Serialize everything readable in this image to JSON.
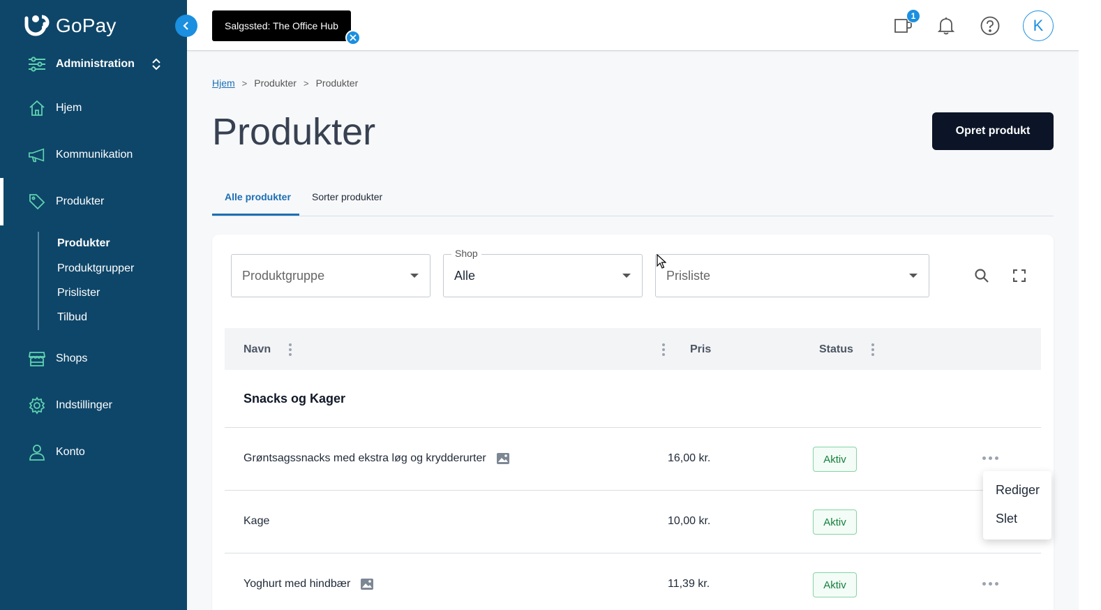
{
  "app": {
    "brand": "GoPay"
  },
  "sidebar": {
    "items": [
      {
        "label": "Administration",
        "icon": "sliders-icon"
      },
      {
        "label": "Hjem",
        "icon": "home-icon"
      },
      {
        "label": "Kommunikation",
        "icon": "megaphone-icon"
      },
      {
        "label": "Produkter",
        "icon": "tag-icon"
      },
      {
        "label": "Shops",
        "icon": "store-icon"
      },
      {
        "label": "Indstillinger",
        "icon": "gear-icon"
      },
      {
        "label": "Konto",
        "icon": "user-icon"
      }
    ],
    "subitems": [
      {
        "label": "Produkter"
      },
      {
        "label": "Produktgrupper"
      },
      {
        "label": "Prislister"
      },
      {
        "label": "Tilbud"
      }
    ]
  },
  "topbar": {
    "salgssted": "Salgssted: The Office Hub",
    "cart_badge": "1",
    "avatar_initial": "K"
  },
  "breadcrumb": {
    "home": "Hjem",
    "level1": "Produkter",
    "level2": "Produkter"
  },
  "page": {
    "title": "Produkter",
    "create_button": "Opret produkt"
  },
  "tabs": [
    {
      "label": "Alle produkter"
    },
    {
      "label": "Sorter produkter"
    }
  ],
  "filters": {
    "produktgruppe": {
      "placeholder": "Produktgruppe"
    },
    "shop": {
      "legend": "Shop",
      "value": "Alle"
    },
    "prisliste": {
      "placeholder": "Prisliste"
    }
  },
  "table": {
    "columns": {
      "name": "Navn",
      "price": "Pris",
      "status": "Status"
    },
    "group": "Snacks og Kager",
    "rows": [
      {
        "name": "Grøntsagssnacks med ekstra løg og krydderurter",
        "price": "16,00 kr.",
        "status": "Aktiv"
      },
      {
        "name": "Kage",
        "price": "10,00 kr.",
        "status": "Aktiv"
      },
      {
        "name": "Yoghurt med hindbær",
        "price": "11,39 kr.",
        "status": "Aktiv"
      }
    ]
  },
  "context_menu": {
    "edit": "Rediger",
    "delete": "Slet"
  },
  "colors": {
    "sidebar": "#0e4669",
    "accent": "#1b8fe0",
    "link": "#1b6fb5",
    "primary_button": "#0b1527",
    "status_green": "#14803c"
  }
}
